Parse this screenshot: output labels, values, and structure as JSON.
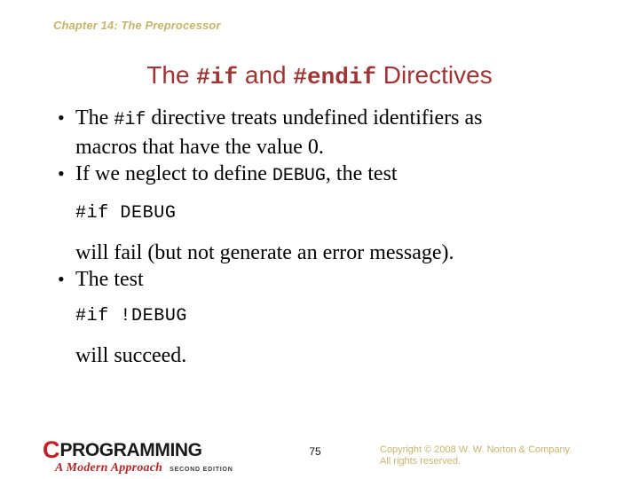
{
  "slide": {
    "chapter_header": "Chapter 14: The Preprocessor",
    "title": {
      "part1": "The ",
      "code1": "#if",
      "part2": " and ",
      "code2": "#endif",
      "part3": " Directives"
    },
    "body": {
      "bullet1": {
        "marker": "•",
        "line1_pre": "The ",
        "line1_code": "#if",
        "line1_post": " directive treats undefined identifiers as",
        "line2": "macros that have the value 0."
      },
      "bullet2": {
        "marker": "•",
        "pre": "If we neglect to define ",
        "code": "DEBUG",
        "post": ", the test"
      },
      "code1": "#if DEBUG",
      "after_code1": "will fail (but not generate an error message).",
      "bullet3": {
        "marker": "•",
        "text": "The test"
      },
      "code2": "#if !DEBUG",
      "after_code2": "will succeed."
    }
  },
  "footer": {
    "logo": {
      "letter": "C",
      "word": "PROGRAMMING",
      "subtitle": "A Modern Approach",
      "edition": "SECOND EDITION"
    },
    "page_number": "75",
    "copyright_line1": "Copyright © 2008 W. W. Norton & Company.",
    "copyright_line2": "All rights reserved."
  },
  "colors": {
    "header_tan": "#c6b56b",
    "title_red": "#a03434",
    "logo_red": "#c12028",
    "subtitle_red": "#b12a2a",
    "text_black": "#000000",
    "background": "#ffffff"
  }
}
